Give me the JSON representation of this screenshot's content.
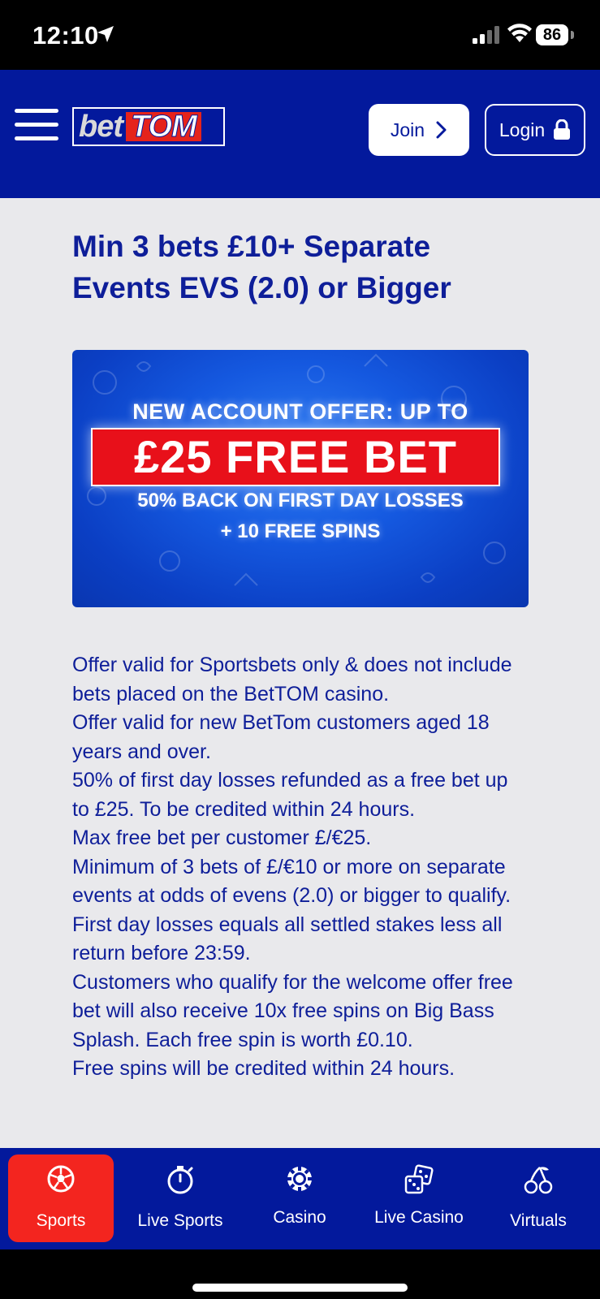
{
  "status_bar": {
    "time": "12:10",
    "battery": "86"
  },
  "header": {
    "logo_bet": "bet",
    "logo_tom": "TOM",
    "join_label": "Join",
    "login_label": "Login"
  },
  "main": {
    "title": "Min 3 bets £10+ Separate Events EVS (2.0) or Bigger",
    "banner": {
      "line1": "NEW ACCOUNT OFFER: UP TO",
      "line2": "£25 FREE BET",
      "line3": "50% BACK ON FIRST DAY LOSSES",
      "line4": "+  10 FREE SPINS"
    },
    "terms": [
      "Offer valid for Sportsbets only & does not include bets placed on the BetTOM casino.",
      "Offer valid for new BetTom customers aged 18 years and over.",
      "50% of first day losses refunded as a free bet up to £25. To be credited within 24 hours.",
      "Max free bet per customer £/€25.",
      "Minimum of 3 bets of £/€10 or more on separate events at odds of evens (2.0) or bigger to qualify.",
      "First day losses equals all settled stakes less all return before 23:59.",
      "Customers who qualify for the welcome offer free bet will also receive 10x free spins on Big Bass Splash. Each free spin is worth £0.10.",
      "Free spins will be credited within 24 hours."
    ]
  },
  "bottom_nav": {
    "items": [
      {
        "label": "Sports",
        "icon": "soccer-ball-icon",
        "active": true
      },
      {
        "label": "Live Sports",
        "icon": "stopwatch-icon",
        "active": false
      },
      {
        "label": "Casino",
        "icon": "casino-chip-icon",
        "active": false
      },
      {
        "label": "Live Casino",
        "icon": "dice-icon",
        "active": false
      },
      {
        "label": "Virtuals",
        "icon": "cherries-icon",
        "active": false
      }
    ]
  },
  "colors": {
    "brand_blue": "#03199c",
    "text_blue": "#0e1e99",
    "accent_red": "#f3251f",
    "page_bg": "#e9e9ec"
  }
}
